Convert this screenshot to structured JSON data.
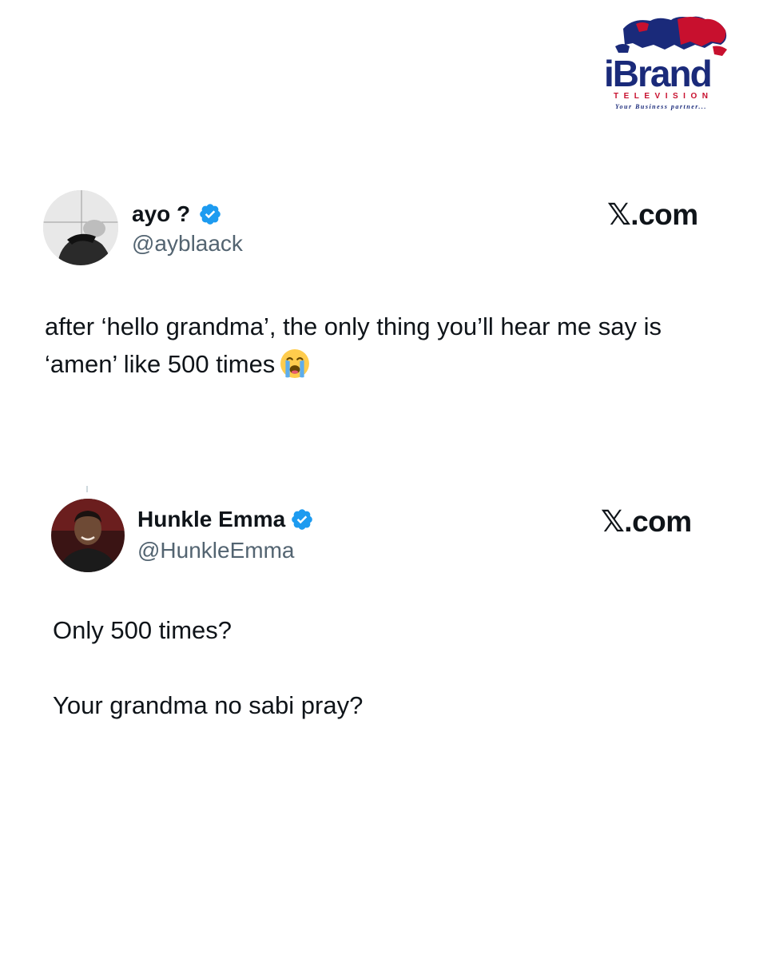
{
  "logo": {
    "brand": "iBrand",
    "subtitle": "TELEVISION",
    "tagline": "Your Business partner..."
  },
  "tweets": [
    {
      "display_name": "ayo ?",
      "handle": "@ayblaack",
      "verified": true,
      "site": "𝕏.com",
      "text": "after ‘hello grandma’, the only thing you’ll hear me say is ‘amen’ like 500 times",
      "emoji": "loudly-crying-face"
    },
    {
      "display_name": "Hunkle Emma",
      "handle": "@HunkleEmma",
      "verified": true,
      "site": "𝕏.com",
      "text": "Only 500 times?\n\nYour grandma no sabi pray?"
    }
  ],
  "colors": {
    "verified_blue": "#1d9bf0",
    "handle_gray": "#536471",
    "brand_red": "#c8102e",
    "brand_navy": "#1a2a7a"
  }
}
